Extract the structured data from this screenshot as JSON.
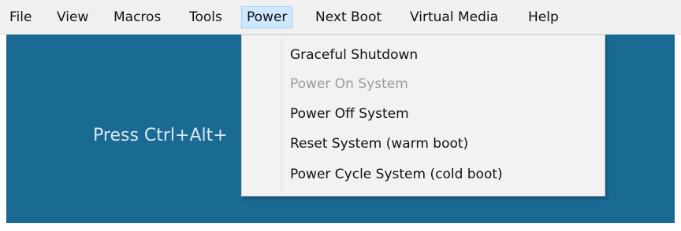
{
  "menubar": {
    "items": [
      {
        "label": "File"
      },
      {
        "label": "View"
      },
      {
        "label": "Macros"
      },
      {
        "label": "Tools"
      },
      {
        "label": "Power",
        "active": true
      },
      {
        "label": "Next Boot"
      },
      {
        "label": "Virtual Media"
      },
      {
        "label": "Help"
      }
    ]
  },
  "console": {
    "text": "Press Ctrl+Alt+"
  },
  "power_menu": {
    "items": [
      {
        "label": "Graceful Shutdown",
        "enabled": true
      },
      {
        "label": "Power On System",
        "enabled": false
      },
      {
        "label": "Power Off System",
        "enabled": true
      },
      {
        "label": "Reset System (warm boot)",
        "enabled": true
      },
      {
        "label": "Power Cycle System (cold boot)",
        "enabled": true
      }
    ]
  },
  "colors": {
    "console_bg": "#1a6b94",
    "menubar_bg": "#f0f0f0",
    "active_menu_bg": "#cde8ff",
    "disabled_text": "#9b9b9b"
  }
}
